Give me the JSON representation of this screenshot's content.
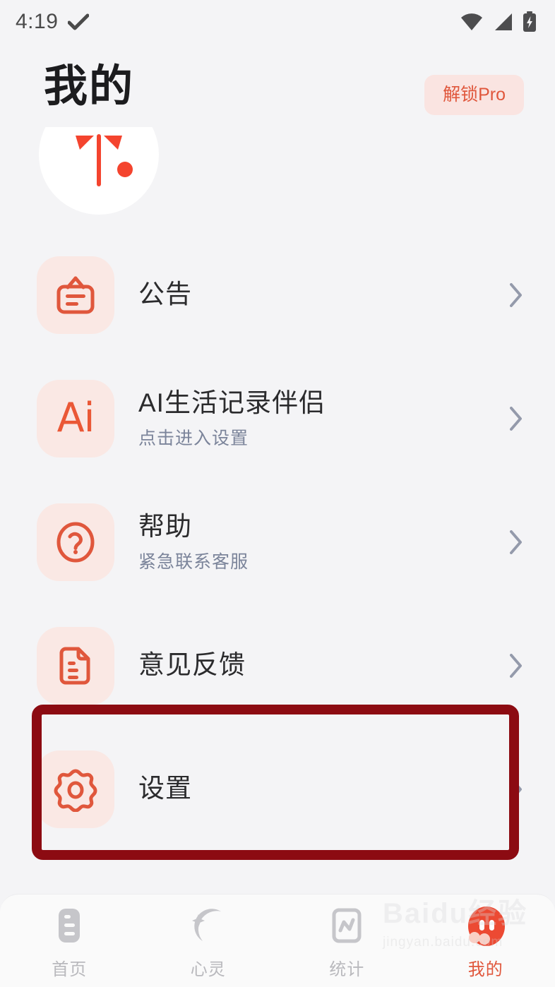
{
  "statusbar": {
    "time": "4:19",
    "icons": [
      "check-icon",
      "wifi-icon",
      "signal-icon",
      "battery-charging-icon"
    ]
  },
  "header": {
    "title": "我的",
    "pro_button": "解锁Pro",
    "logo": "app-logo-mark"
  },
  "menu": {
    "items": [
      {
        "icon": "announcement-board-icon",
        "title": "公告",
        "subtitle": "",
        "chevron": "chevron-right-icon"
      },
      {
        "icon": "ai-icon",
        "icon_text": "Ai",
        "title": "AI生活记录伴侣",
        "subtitle": "点击进入设置",
        "chevron": "chevron-right-icon"
      },
      {
        "icon": "question-circle-icon",
        "title": "帮助",
        "subtitle": "紧急联系客服",
        "chevron": "chevron-right-icon"
      },
      {
        "icon": "document-lines-icon",
        "title": "意见反馈",
        "subtitle": "",
        "chevron": "chevron-right-icon"
      },
      {
        "icon": "settings-gear-flower-icon",
        "title": "设置",
        "subtitle": "",
        "chevron": "chevron-right-icon"
      }
    ]
  },
  "highlight": {
    "target": "设置",
    "color": "#8c0b12"
  },
  "tabbar": {
    "tabs": [
      {
        "label": "首页",
        "icon": "home-list-icon",
        "active": false
      },
      {
        "label": "心灵",
        "icon": "moon-star-icon",
        "active": false
      },
      {
        "label": "统计",
        "icon": "stats-chart-icon",
        "active": false
      },
      {
        "label": "我的",
        "icon": "profile-face-icon",
        "active": true
      }
    ]
  },
  "watermark": {
    "main": "Baidu经验",
    "sub": "jingyan.baidu.com"
  },
  "colors": {
    "accent": "#e0573c",
    "icon_bg": "#fae8e4",
    "page_bg": "#f4f4f6",
    "highlight": "#8c0b12",
    "tab_inactive": "#b9b9bd"
  }
}
